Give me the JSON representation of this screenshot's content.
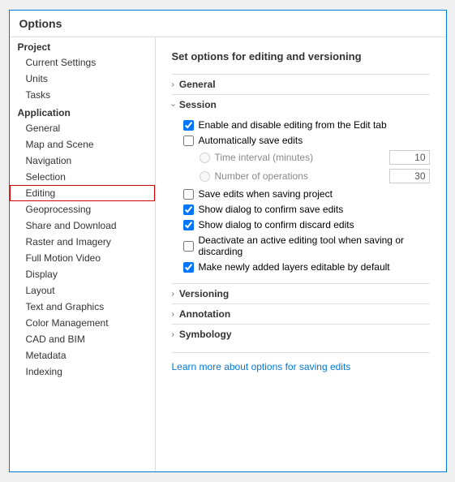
{
  "dialog": {
    "title": "Options",
    "main_heading": "Set options for editing and versioning"
  },
  "sidebar": {
    "project_header": "Project",
    "application_header": "Application",
    "items_project": [
      {
        "label": "Current Settings",
        "id": "current-settings"
      },
      {
        "label": "Units",
        "id": "units"
      },
      {
        "label": "Tasks",
        "id": "tasks"
      }
    ],
    "items_application": [
      {
        "label": "General",
        "id": "general"
      },
      {
        "label": "Map and Scene",
        "id": "map-and-scene"
      },
      {
        "label": "Navigation",
        "id": "navigation"
      },
      {
        "label": "Selection",
        "id": "selection"
      },
      {
        "label": "Editing",
        "id": "editing",
        "active": true
      },
      {
        "label": "Geoprocessing",
        "id": "geoprocessing"
      },
      {
        "label": "Share and Download",
        "id": "share-and-download"
      },
      {
        "label": "Raster and Imagery",
        "id": "raster-and-imagery"
      },
      {
        "label": "Full Motion Video",
        "id": "full-motion-video"
      },
      {
        "label": "Display",
        "id": "display"
      },
      {
        "label": "Layout",
        "id": "layout"
      },
      {
        "label": "Text and Graphics",
        "id": "text-and-graphics"
      },
      {
        "label": "Color Management",
        "id": "color-management"
      },
      {
        "label": "CAD and BIM",
        "id": "cad-and-bim"
      },
      {
        "label": "Metadata",
        "id": "metadata"
      },
      {
        "label": "Indexing",
        "id": "indexing"
      }
    ]
  },
  "sections": {
    "general": {
      "label": "General",
      "collapsed": true,
      "chevron": "›"
    },
    "session": {
      "label": "Session",
      "collapsed": false,
      "chevron": "›",
      "checkboxes": [
        {
          "label": "Enable and disable editing from the Edit tab",
          "checked": true,
          "id": "enable-disable"
        },
        {
          "label": "Automatically save edits",
          "checked": false,
          "id": "auto-save"
        }
      ],
      "radios": [
        {
          "label": "Time interval (minutes)",
          "value": "10",
          "id": "time-interval",
          "enabled": true
        },
        {
          "label": "Number of operations",
          "value": "30",
          "id": "num-operations",
          "enabled": false
        }
      ],
      "checkboxes2": [
        {
          "label": "Save edits when saving project",
          "checked": false,
          "id": "save-edits-project"
        },
        {
          "label": "Show dialog to confirm save edits",
          "checked": true,
          "id": "confirm-save"
        },
        {
          "label": "Show dialog to confirm discard edits",
          "checked": true,
          "id": "confirm-discard"
        },
        {
          "label": "Deactivate an active editing tool when saving or discarding",
          "checked": false,
          "id": "deactivate-tool"
        },
        {
          "label": "Make newly added layers editable by default",
          "checked": true,
          "id": "editable-default"
        }
      ]
    },
    "versioning": {
      "label": "Versioning",
      "collapsed": true,
      "chevron": "›"
    },
    "annotation": {
      "label": "Annotation",
      "collapsed": true,
      "chevron": "›"
    },
    "symbology": {
      "label": "Symbology",
      "collapsed": true,
      "chevron": "›"
    }
  },
  "learn_more": "Learn more about options for saving edits"
}
